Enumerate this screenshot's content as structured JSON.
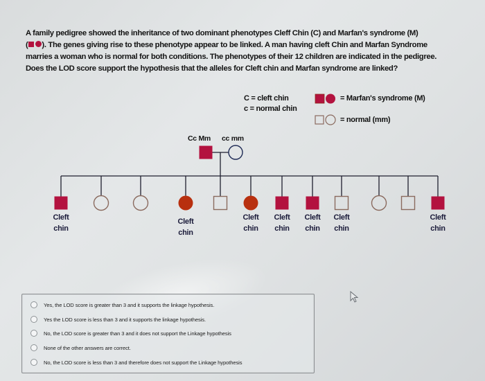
{
  "question": {
    "line1": "A family pedigree showed the inheritance of two dominant phenotypes Cleff Chin (C) and Marfan's syndrome (M)",
    "line2_open": "(",
    "line2_rest": "). The genes giving rise to these phenotype appear to be linked.  A man having cleft Chin and Marfan Syndrome",
    "line3": "marries a woman who is normal for both conditions.  The phenotypes of their 12 children are indicated in the pedigree.",
    "line4": "Does the LOD score support the hypothesis that the alleles for Cleft chin and Marfan syndrome are linked?"
  },
  "legend": {
    "cleft_key": "C = cleft chin",
    "normal_key": "c = normal chin",
    "affected_label": "= Marfan's syndrome (M)",
    "normal_label": "= normal (mm)"
  },
  "colors": {
    "affected_square": "#b3123f",
    "affected_circle": "#b8300f",
    "normal_outline": "#8a6a5e",
    "line": "#1e1e2e"
  },
  "parents": {
    "father": {
      "genotype": "Cc Mm",
      "sex": "male",
      "marfan": true
    },
    "mother": {
      "genotype": "cc mm",
      "sex": "female",
      "marfan": false
    }
  },
  "children": [
    {
      "sex": "male",
      "marfan": true,
      "label": "Cleft chin"
    },
    {
      "sex": "female",
      "marfan": false,
      "label": ""
    },
    {
      "sex": "female",
      "marfan": false,
      "label": ""
    },
    {
      "sex": "female",
      "marfan": true,
      "label": "Cleft chin"
    },
    {
      "sex": "male",
      "marfan": false,
      "label": ""
    },
    {
      "sex": "female",
      "marfan": true,
      "label": "Cleft chin"
    },
    {
      "sex": "male",
      "marfan": true,
      "label": "Cleft chin"
    },
    {
      "sex": "male",
      "marfan": true,
      "label": "Cleft chin"
    },
    {
      "sex": "male",
      "marfan": false,
      "label": "Cleft chin"
    },
    {
      "sex": "female",
      "marfan": false,
      "label": ""
    },
    {
      "sex": "male",
      "marfan": false,
      "label": ""
    },
    {
      "sex": "male",
      "marfan": true,
      "label": "Cleft chin"
    }
  ],
  "answers": {
    "options": [
      "Yes, the LOD score is greater than 3 and it supports the linkage hypothesis.",
      "Yes the LOD score is less than 3 and it supports the linkage hypothesis.",
      "No, the LOD score is greater than 3 and it does not support the Linkage hypothesis",
      "None of the other answers are correct.",
      "No, the LOD score is less than 3 and therefore does not support the Linkage hypothesis"
    ],
    "selected": null
  }
}
